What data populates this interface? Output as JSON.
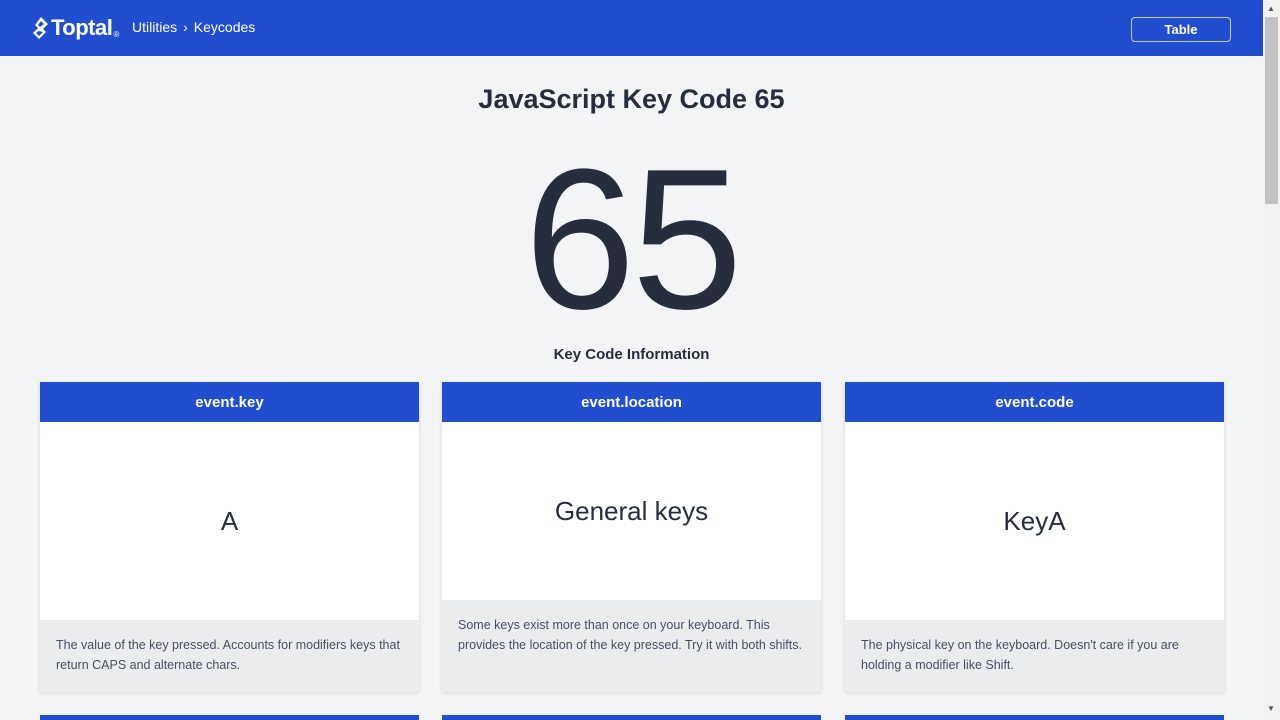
{
  "header": {
    "logo_text": "Toptal",
    "logo_dot": "®",
    "breadcrumb": [
      "Utilities",
      "Keycodes"
    ],
    "breadcrumb_separator": "›",
    "table_button": "Table"
  },
  "main": {
    "title": "JavaScript Key Code 65",
    "keycode": "65",
    "info_heading": "Key Code Information",
    "cards": [
      {
        "title": "event.key",
        "value": "A",
        "description": "The value of the key pressed. Accounts for modifiers keys that return CAPS and alternate chars."
      },
      {
        "title": "event.location",
        "value": "General keys",
        "description": "Some keys exist more than once on your keyboard. This provides the location of the key pressed. Try it with both shifts."
      },
      {
        "title": "event.code",
        "value": "KeyA",
        "description": "The physical key on the keyboard. Doesn't care if you are holding a modifier like Shift."
      }
    ]
  },
  "colors": {
    "brand": "#204ecf",
    "background": "#f3f4f6",
    "text": "#262d3d"
  },
  "icons": {
    "logo": "toptal-logo-icon",
    "scroll_up": "scroll-up-arrow-icon",
    "scroll_down": "scroll-down-arrow-icon"
  }
}
